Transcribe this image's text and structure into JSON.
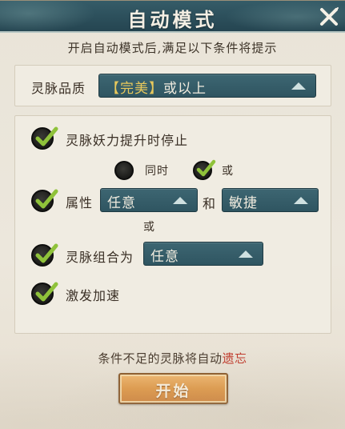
{
  "dialog": {
    "title": "自动模式",
    "subtitle": "开启自动模式后,满足以下条件将提示"
  },
  "quality": {
    "label": "灵脉品质",
    "dropdown_highlight": "【完美】",
    "dropdown_suffix": "或以上"
  },
  "conditions": {
    "power_increase_label": "灵脉妖力提升时停止",
    "power_increase_checked": true,
    "mode_same_time_label": "同时",
    "mode_same_time_selected": false,
    "mode_or_label": "或",
    "mode_or_selected": true,
    "attribute_label": "属性",
    "attribute_checked": true,
    "attribute_value_1": "任意",
    "attribute_joiner": "和",
    "attribute_value_2": "敏捷",
    "or_separator": "或",
    "combo_label": "灵脉组合为",
    "combo_checked": true,
    "combo_value": "任意",
    "accelerate_label": "激发加速",
    "accelerate_checked": true
  },
  "footer": {
    "note_prefix": "条件不足的灵脉将自动",
    "note_action": "遗忘",
    "note_action_color": "#c0392b",
    "start_label": "开始"
  },
  "icons": {
    "close": "close-icon",
    "check": "checkmark-icon",
    "dropdown_arrow": "triangle-up-icon"
  }
}
